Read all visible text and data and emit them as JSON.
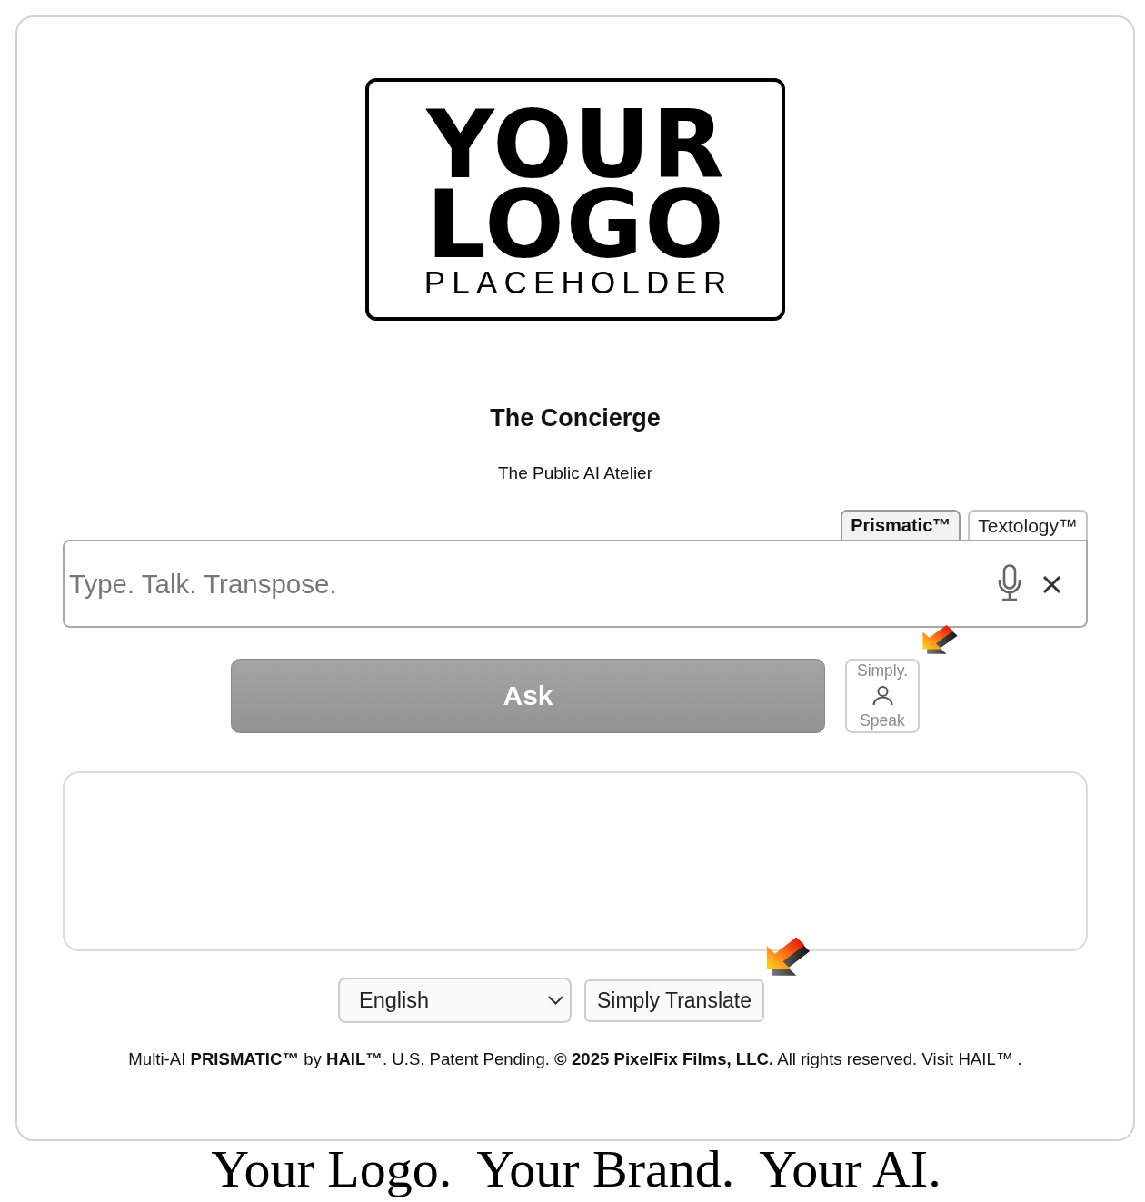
{
  "logo": {
    "lines": [
      "YOUR",
      "LOGO"
    ],
    "subtitle": "PLACEHOLDER"
  },
  "header": {
    "title": "The Concierge",
    "subtitle": "The Public AI Atelier"
  },
  "tabs": [
    {
      "label": "Prismatic™",
      "selected": true
    },
    {
      "label": "Textology™",
      "selected": false
    }
  ],
  "query": {
    "placeholder": "Type. Talk. Transpose."
  },
  "ask_button": {
    "label": "Ask",
    "disabled": true
  },
  "speak_button": {
    "top": "Simply.",
    "bottom": "Speak"
  },
  "language_select": {
    "value": "English"
  },
  "translate_button": {
    "label": "Simply Translate"
  },
  "footer": "Multi-AI **PRISMATIC™** by **HAIL™**. U.S. Patent Pending. **© 2025 PixelFix Films, LLC.** All rights reserved. Visit HAIL™ .",
  "tagline": [
    "Your Logo.",
    "Your Brand.",
    "Your AI."
  ]
}
